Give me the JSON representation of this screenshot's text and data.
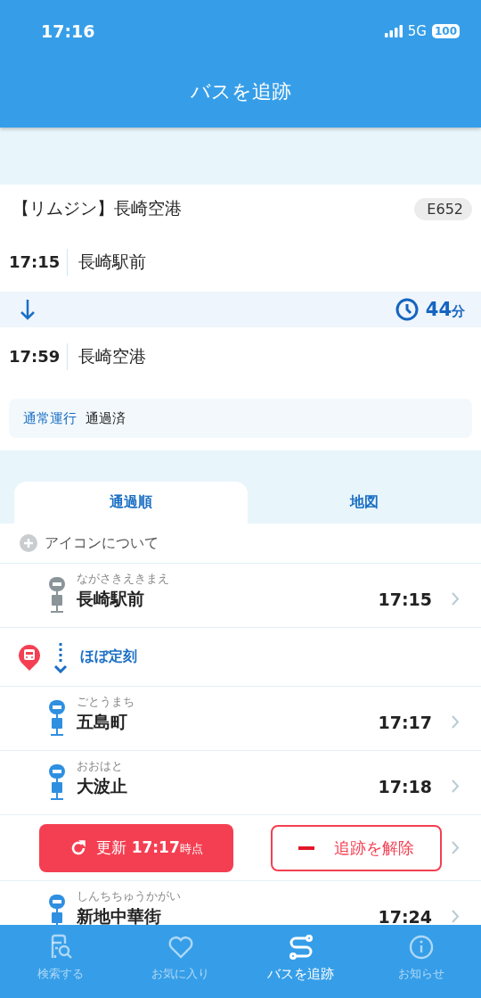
{
  "status_bar": {
    "time": "17:16",
    "network": "5G",
    "battery": "100"
  },
  "header": {
    "title": "バスを追跡"
  },
  "route": {
    "name": "【リムジン】長崎空港",
    "bus_number": "E652",
    "departure": {
      "time": "17:15",
      "stop": "長崎駅前"
    },
    "duration": {
      "value": "44",
      "unit": "分"
    },
    "arrival": {
      "time": "17:59",
      "stop": "長崎空港"
    },
    "status": {
      "operation": "通常運行",
      "progress": "通過済"
    }
  },
  "tabs": [
    {
      "label": "通過順",
      "selected": true
    },
    {
      "label": "地図",
      "selected": false
    }
  ],
  "legend_link": "アイコンについて",
  "stops": [
    {
      "kind": "stop",
      "reading": "ながさきえきまえ",
      "name": "長崎駅前",
      "time": "17:15",
      "passed": true
    },
    {
      "kind": "bus",
      "label": "ほぼ定刻"
    },
    {
      "kind": "stop",
      "reading": "ごとうまち",
      "name": "五島町",
      "time": "17:17",
      "passed": false
    },
    {
      "kind": "stop",
      "reading": "おおはと",
      "name": "大波止",
      "time": "17:18",
      "passed": false
    },
    {
      "kind": "actions",
      "refresh_label": "更新",
      "refresh_time": "17:17",
      "refresh_suffix": "時点",
      "release_label": "追跡を解除"
    },
    {
      "kind": "stop",
      "reading": "しんちちゅうかがい",
      "name": "新地中華街",
      "time": "17:24",
      "passed": false
    }
  ],
  "tab_bar": [
    {
      "kind": "search",
      "label": "検索する",
      "selected": false
    },
    {
      "kind": "favorite",
      "label": "お気に入り",
      "selected": false
    },
    {
      "kind": "track",
      "label": "バスを追跡",
      "selected": true
    },
    {
      "kind": "info",
      "label": "お知らせ",
      "selected": false
    }
  ]
}
